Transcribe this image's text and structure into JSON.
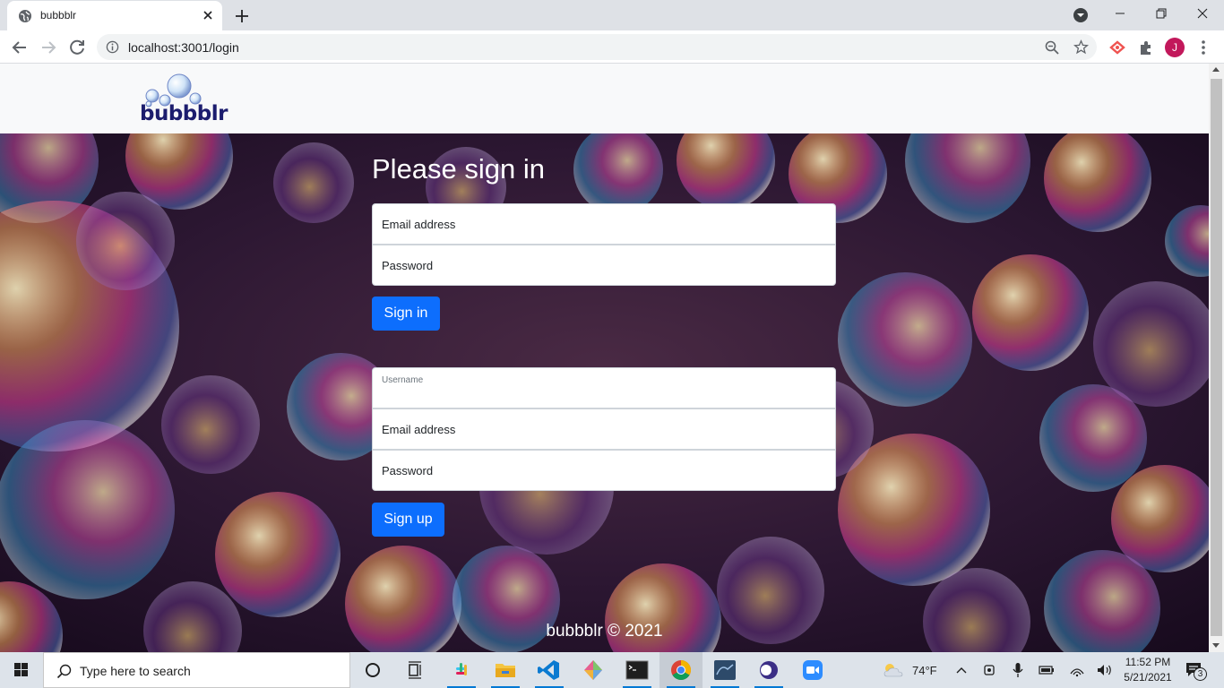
{
  "browser": {
    "tab_title": "bubbblr",
    "url": "localhost:3001/login",
    "profile_initial": "J"
  },
  "page": {
    "brand": "bubbblr",
    "signin": {
      "heading": "Please sign in",
      "email_placeholder": "Email address",
      "password_placeholder": "Password",
      "button": "Sign in"
    },
    "signup": {
      "username_label": "Username",
      "email_placeholder": "Email address",
      "password_placeholder": "Password",
      "button": "Sign up"
    },
    "footer": "bubbblr © 2021"
  },
  "taskbar": {
    "search_placeholder": "Type here to search",
    "weather": "74°F",
    "time": "11:52 PM",
    "date": "5/21/2021",
    "notification_count": "3"
  },
  "colors": {
    "primary_button": "#0d6efd",
    "brand_text": "#1c1d6e",
    "avatar": "#c2185b"
  }
}
